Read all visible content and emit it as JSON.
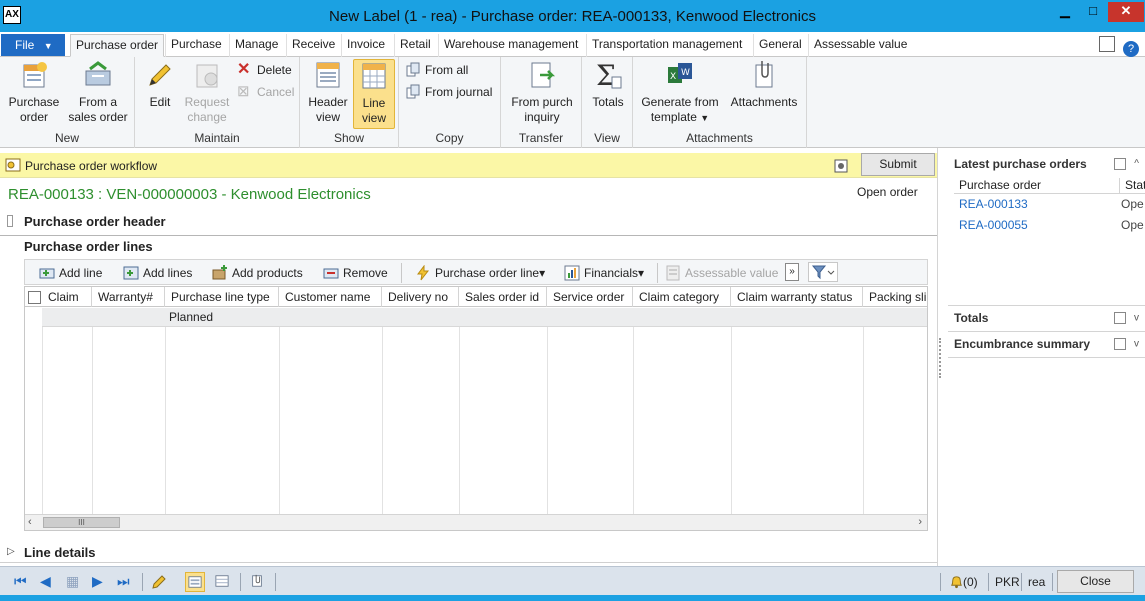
{
  "window": {
    "title": "New Label (1 - rea) - Purchase order: REA-000133, Kenwood Electronics",
    "app_icon": "dynamics-ax-icon",
    "min_glyph": "▁",
    "max_glyph": "□",
    "close_glyph": "✕"
  },
  "tabs": {
    "file_label": "File",
    "items": [
      {
        "label": "Purchase order"
      },
      {
        "label": "Purchase"
      },
      {
        "label": "Manage"
      },
      {
        "label": "Receive"
      },
      {
        "label": "Invoice"
      },
      {
        "label": "Retail"
      },
      {
        "label": "Warehouse management"
      },
      {
        "label": "Transportation management"
      },
      {
        "label": "General"
      },
      {
        "label": "Assessable value"
      }
    ],
    "help_glyph": "?"
  },
  "ribbon": {
    "new": {
      "label": "New",
      "purchase_order": "Purchase order",
      "from_sales_order": "From a sales order"
    },
    "maintain": {
      "label": "Maintain",
      "edit": "Edit",
      "request_change": "Request change",
      "delete": "Delete",
      "cancel": "Cancel"
    },
    "show": {
      "label": "Show",
      "header_view": "Header view",
      "line_view": "Line view"
    },
    "copy": {
      "label": "Copy",
      "from_all": "From all",
      "from_journal": "From journal"
    },
    "transfer": {
      "label": "Transfer",
      "from_purch_inquiry": "From purch inquiry"
    },
    "view": {
      "label": "View",
      "totals": "Totals"
    },
    "attachments": {
      "label": "Attachments",
      "generate_from_template": "Generate from template",
      "attachments": "Attachments"
    }
  },
  "workflow": {
    "text": "Purchase order workflow",
    "submit": "Submit"
  },
  "record": {
    "title": "REA-000133 : VEN-000000003 - Kenwood Electronics",
    "status": "Open order"
  },
  "sections": {
    "header": "Purchase order header",
    "lines": "Purchase order lines",
    "line_details": "Line details",
    "expand_glyph": "▷"
  },
  "lines_toolbar": {
    "add_line": "Add line",
    "add_lines": "Add lines",
    "add_products": "Add products",
    "remove": "Remove",
    "purchase_order_line": "Purchase order line",
    "financials": "Financials",
    "assessable_value": "Assessable value",
    "more_glyph": "»",
    "dropdown_glyph": "▾"
  },
  "grid": {
    "columns": [
      "Claim",
      "Warranty#",
      "Purchase line type",
      "Customer name",
      "Delivery no",
      "Sales order id",
      "Service order",
      "Claim category",
      "Claim warranty status",
      "Packing sli"
    ],
    "rows": [
      {
        "purchase_line_type": "Planned"
      }
    ],
    "scroll_left": "‹",
    "scroll_right": "›",
    "thumb_glyph": "III"
  },
  "right_panel": {
    "latest_title": "Latest purchase orders",
    "col_purchase_order": "Purchase order",
    "col_status": "Stat",
    "orders": [
      {
        "id": "REA-000133",
        "status": "Ope"
      },
      {
        "id": "REA-000055",
        "status": "Ope"
      }
    ],
    "totals_title": "Totals",
    "encumbrance_title": "Encumbrance summary",
    "collapse_glyph": "^",
    "expand_glyph": "v"
  },
  "statusbar": {
    "nav_glyphs": [
      "⏮",
      "◀",
      "▦",
      "▶",
      "⏭"
    ],
    "notifications": "(0)",
    "currency": "PKR",
    "company": "rea",
    "close": "Close"
  },
  "colors": {
    "titlebar": "#1ba1e2",
    "file_button": "#1f6bc4",
    "workflow_bar": "#fbf7a6",
    "record_title": "#2e8f2e",
    "selected_button": "#fbe08c"
  }
}
